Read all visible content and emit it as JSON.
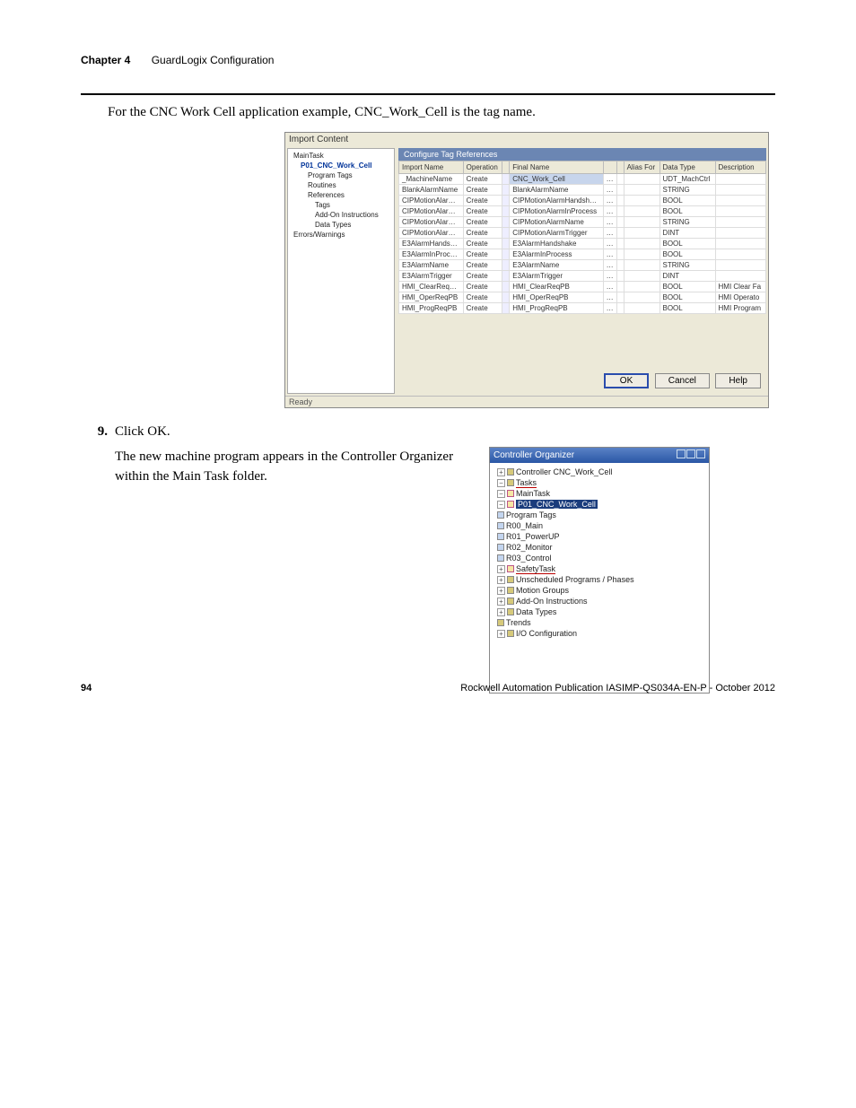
{
  "header": {
    "chapter": "Chapter 4",
    "title": "GuardLogix Configuration"
  },
  "intro": "For the CNC Work Cell application example, CNC_Work_Cell is the tag name.",
  "shot1": {
    "title": "Import Content",
    "tree": {
      "root": "MainTask",
      "prog": "P01_CNC_Work_Cell",
      "items": [
        "Program Tags",
        "Routines",
        "References",
        "Tags",
        "Add-On Instructions",
        "Data Types"
      ],
      "err": "Errors/Warnings"
    },
    "tab": "Configure Tag References",
    "cols": [
      "Import Name",
      "Operation",
      "",
      "Final Name",
      "",
      "",
      "Alias For",
      "Data Type",
      "Description"
    ],
    "rows": [
      {
        "imp": "_MachineName",
        "op": "Create",
        "fn": "CNC_Work_Cell",
        "dt": "UDT_MachCtrl",
        "sel": true
      },
      {
        "imp": "BlankAlarmName",
        "op": "Create",
        "fn": "BlankAlarmName",
        "dt": "STRING"
      },
      {
        "imp": "CIPMotionAlar…",
        "op": "Create",
        "fn": "CIPMotionAlarmHandsh…",
        "dt": "BOOL"
      },
      {
        "imp": "CIPMotionAlar…",
        "op": "Create",
        "fn": "CIPMotionAlarmInProcess",
        "dt": "BOOL"
      },
      {
        "imp": "CIPMotionAlar…",
        "op": "Create",
        "fn": "CIPMotionAlarmName",
        "dt": "STRING"
      },
      {
        "imp": "CIPMotionAlar…",
        "op": "Create",
        "fn": "CIPMotionAlarmTrigger",
        "dt": "DINT"
      },
      {
        "imp": "E3AlarmHands…",
        "op": "Create",
        "fn": "E3AlarmHandshake",
        "dt": "BOOL"
      },
      {
        "imp": "E3AlarmInProc…",
        "op": "Create",
        "fn": "E3AlarmInProcess",
        "dt": "BOOL"
      },
      {
        "imp": "E3AlarmName",
        "op": "Create",
        "fn": "E3AlarmName",
        "dt": "STRING"
      },
      {
        "imp": "E3AlarmTrigger",
        "op": "Create",
        "fn": "E3AlarmTrigger",
        "dt": "DINT"
      },
      {
        "imp": "HMI_ClearReq…",
        "op": "Create",
        "fn": "HMI_ClearReqPB",
        "dt": "BOOL",
        "desc": "HMI Clear Fa"
      },
      {
        "imp": "HMI_OperReqPB",
        "op": "Create",
        "fn": "HMI_OperReqPB",
        "dt": "BOOL",
        "desc": "HMI Operato"
      },
      {
        "imp": "HMI_ProgReqPB",
        "op": "Create",
        "fn": "HMI_ProgReqPB",
        "dt": "BOOL",
        "desc": "HMI Program"
      }
    ],
    "buttons": {
      "ok": "OK",
      "cancel": "Cancel",
      "help": "Help"
    },
    "status": "Ready"
  },
  "step9": {
    "num": "9.",
    "text": "Click OK."
  },
  "para2": "The new machine program appears in the Controller Organizer within the Main Task folder.",
  "org": {
    "title": "Controller Organizer",
    "nodes": {
      "ctrl": "Controller CNC_Work_Cell",
      "tasks": "Tasks",
      "main": "MainTask",
      "p01": "P01_CNC_Work_Cell",
      "ptags": "Program Tags",
      "r00": "R00_Main",
      "r01": "R01_PowerUP",
      "r02": "R02_Monitor",
      "r03": "R03_Control",
      "safety": "SafetyTask",
      "unsched": "Unscheduled Programs / Phases",
      "mg": "Motion Groups",
      "aoi": "Add-On Instructions",
      "dt": "Data Types",
      "tr": "Trends",
      "io": "I/O Configuration"
    }
  },
  "footer": {
    "page": "94",
    "pub": "Rockwell Automation Publication IASIMP-QS034A-EN-P - ",
    "date": "October 2012"
  }
}
